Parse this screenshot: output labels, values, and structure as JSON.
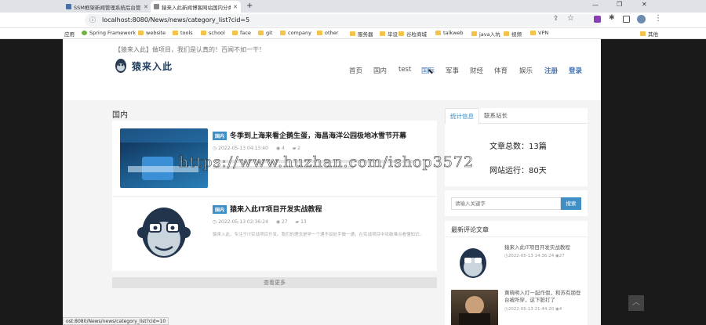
{
  "browser": {
    "tabs": [
      {
        "title": "SSM框架新闻管理系统后台管理"
      },
      {
        "title": "猿来入此新闻博客网站国内分类"
      }
    ],
    "new_tab": "+",
    "url": "localhost:8080/News/news/category_list?cid=5",
    "bookmarks": [
      "应用",
      "Spring Framework",
      "website",
      "tools",
      "school",
      "face",
      "git",
      "company",
      "other",
      "服务器",
      "毕设",
      "谷粒商城",
      "talkweb",
      "java入坑",
      "视频",
      "VPN",
      "其他"
    ],
    "status_url": "ost:8080/News/news/category_list?cid=10"
  },
  "site": {
    "slogan": "【猿来入此】做项目，我们是认真的！百闻不如一干！",
    "logo_text": "猿来入此",
    "nav": [
      "首页",
      "国内",
      "test",
      "国际",
      "军事",
      "财经",
      "体育",
      "娱乐"
    ],
    "register": "注册",
    "login": "登录"
  },
  "main": {
    "section_title": "国内",
    "articles": [
      {
        "tag": "国内",
        "title": "冬季到上海来看企鹅生蛋，海昌海洋公园极地冰雪节开幕",
        "date": "2022-05-13 04:13:40",
        "views": "4",
        "comments": "2",
        "summary": ""
      },
      {
        "tag": "国内",
        "title": "猿来入此IT项目开发实战教程",
        "date": "2022-05-13 02:36:24",
        "views": "27",
        "comments": "13",
        "summary": "猿来入此，专注于IT实战项目开发。我们的理念是学一个通不如处手做一通，在实战项目中攻破难点看懂知识。"
      }
    ],
    "load_more": "查看更多"
  },
  "sidebar": {
    "tabs": [
      "统计信息",
      "联系站长"
    ],
    "article_count": "文章总数：13篇",
    "uptime": "网站运行：80天",
    "search_placeholder": "请输入关键字",
    "search_button": "搜索",
    "recent_title": "最新评论文章",
    "recent": [
      {
        "title": "猿来入此IT项目开发实战教程",
        "date": "2022-05-13 14:36:24",
        "views": "27"
      },
      {
        "title": "黄晓明入打一起作假，和苏有朋登台被所穿，这下脏打了",
        "date": "2022-05-13 21:44:20",
        "views": "4"
      }
    ]
  },
  "watermark": "https://www.huzhan.com/ishop3572",
  "colors": {
    "accent": "#3f8fc5",
    "nav_active": "#3f6fb5"
  }
}
